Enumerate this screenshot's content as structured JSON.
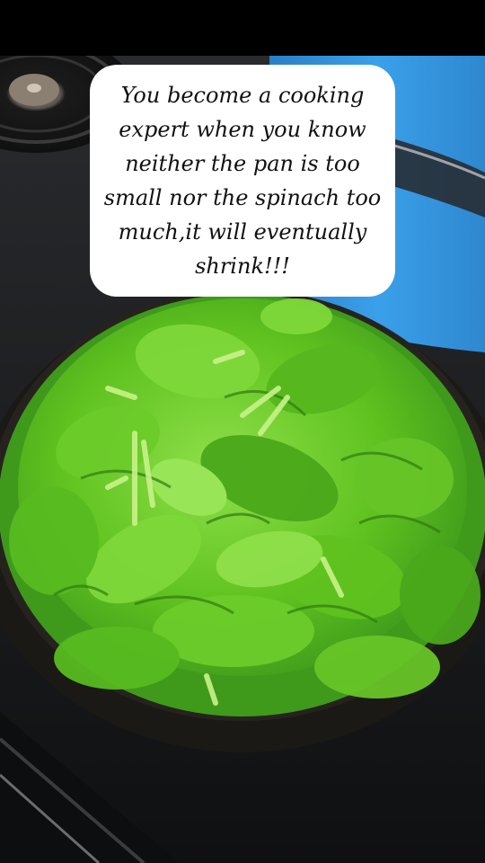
{
  "caption": {
    "text": "You become a cooking expert when you know neither the pan is too small nor the spinach too much,it will eventually shrink!!!"
  },
  "scene": {
    "subject": "spinach-in-pan",
    "colors": {
      "stove": "#1c1d20",
      "pot": "#2f8fd8",
      "pan": "#26231f",
      "spinach_dark": "#3f9a1c",
      "spinach_mid": "#5fc21f",
      "spinach_light": "#8fe04a",
      "stem": "#c9f28a"
    }
  }
}
